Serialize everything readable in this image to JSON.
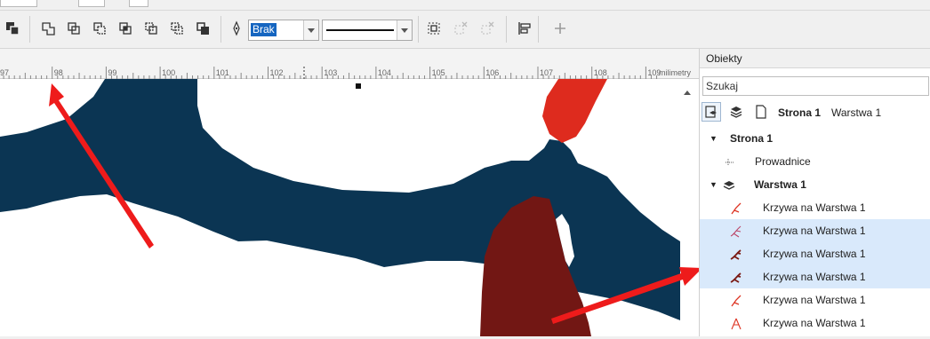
{
  "toolbar": {
    "outline_width": "Brak",
    "buttons": [
      "combine-icon",
      "weld-icon",
      "trim-icon",
      "intersect-icon",
      "simplify-icon",
      "front-minus-back-icon",
      "back-minus-front-icon",
      "create-boundary-icon",
      "pen-icon",
      "convert-to-curves-icon",
      "break-apart-icon",
      "break-apart-disabled-icon",
      "align-distribute-icon",
      "add-icon"
    ]
  },
  "ruler": {
    "labels": [
      "97",
      "98",
      "99",
      "100",
      "101",
      "102",
      "103",
      "104",
      "105",
      "106",
      "107",
      "108",
      "109"
    ],
    "unit": "milimetry"
  },
  "panel": {
    "title": "Obiekty",
    "search_placeholder": "Szukaj",
    "page_label": "Strona 1",
    "layer_label": "Warstwa 1",
    "tree": [
      {
        "label": "Strona 1",
        "bold": true,
        "level": 0,
        "selected": false,
        "icon": "caret"
      },
      {
        "label": "Prowadnice",
        "bold": false,
        "level": 1,
        "selected": false,
        "icon": "guides-icon"
      },
      {
        "label": "Warstwa 1",
        "bold": true,
        "level": 1,
        "selected": false,
        "icon": "layer-icon"
      },
      {
        "label": "Krzywa na Warstwa 1",
        "bold": false,
        "level": 2,
        "selected": false,
        "icon": "curve-red-icon"
      },
      {
        "label": "Krzywa na Warstwa 1",
        "bold": false,
        "level": 2,
        "selected": true,
        "icon": "curve-pink-icon"
      },
      {
        "label": "Krzywa na Warstwa 1",
        "bold": false,
        "level": 2,
        "selected": true,
        "icon": "curve-darkred-icon"
      },
      {
        "label": "Krzywa na Warstwa 1",
        "bold": false,
        "level": 2,
        "selected": true,
        "icon": "curve-darkred-icon"
      },
      {
        "label": "Krzywa na Warstwa 1",
        "bold": false,
        "level": 2,
        "selected": false,
        "icon": "curve-red-icon"
      },
      {
        "label": "Krzywa na Warstwa 1",
        "bold": false,
        "level": 2,
        "selected": false,
        "icon": "curve-red-outline-icon"
      }
    ]
  },
  "colors": {
    "navy_shape": "#0b3553",
    "red_shape": "#de2b1e",
    "darkred_shape": "#721714",
    "arrow": "#ee1b1b",
    "selection": "#d9e9fb",
    "highlight": "#1565c0"
  }
}
